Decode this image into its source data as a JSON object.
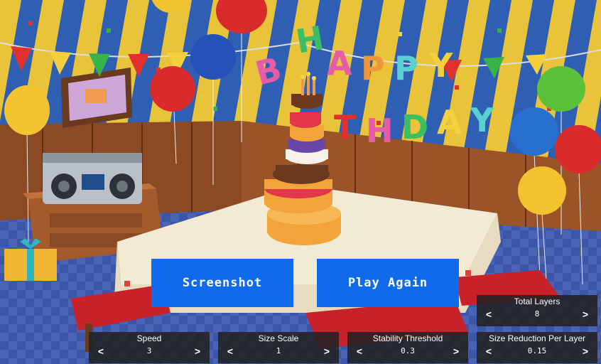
{
  "banner": {
    "line1": "HAPPY",
    "line2": "BIRTHDAY"
  },
  "buttons": {
    "screenshot": "Screenshot",
    "play_again": "Play Again"
  },
  "controls": {
    "total_layers": {
      "label": "Total Layers",
      "value": "8"
    },
    "speed": {
      "label": "Speed",
      "value": "3"
    },
    "size_scale": {
      "label": "Size Scale",
      "value": "1"
    },
    "stability_threshold": {
      "label": "Stability Threshold",
      "value": "0.3"
    },
    "size_reduction": {
      "label": "Size Reduction Per Layer",
      "value": "0.15"
    }
  },
  "arrows": {
    "left": "<",
    "right": ">"
  },
  "colors": {
    "button": "#0f6bea",
    "panel": "#222222",
    "wall_yellow": "#e9c33a",
    "wall_blue": "#2f5fb3"
  }
}
